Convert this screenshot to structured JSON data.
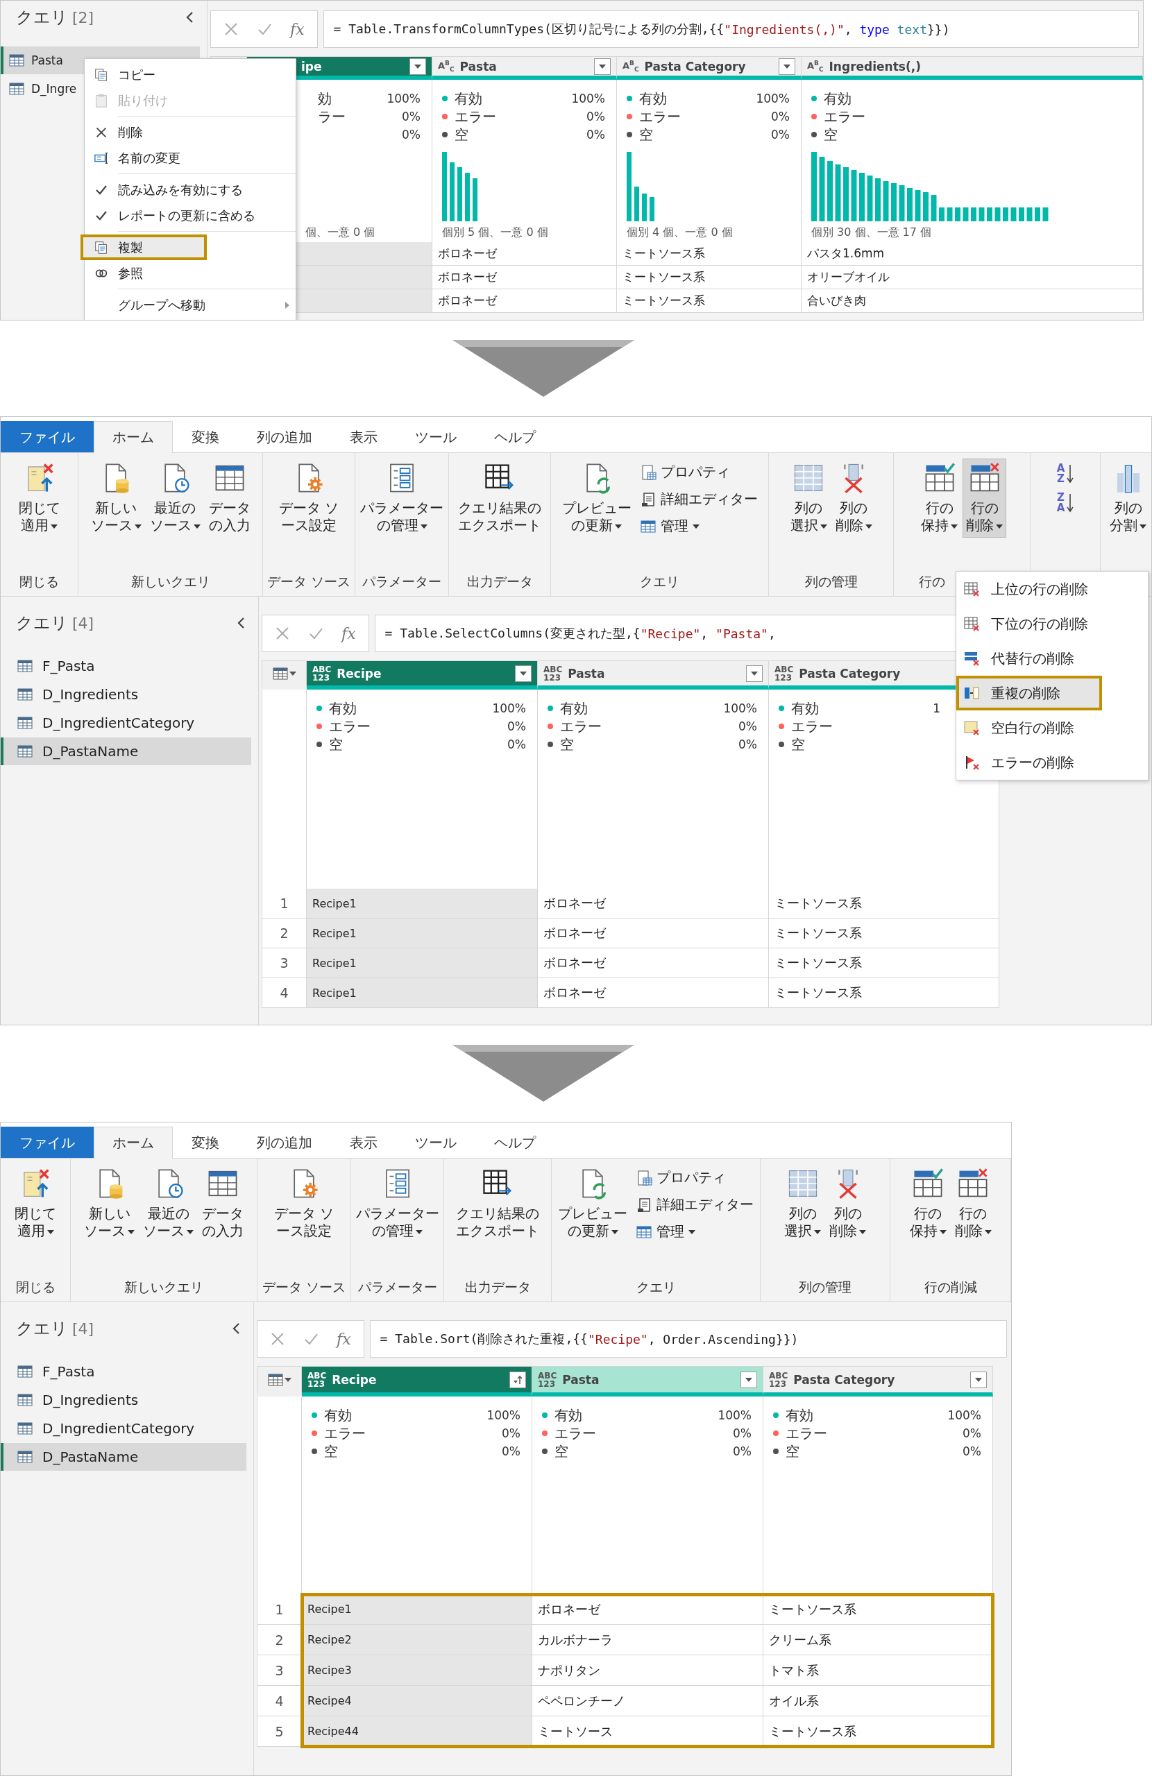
{
  "panels": [
    {
      "sidebar": {
        "title": "クエリ",
        "count": "[2]",
        "items": [
          {
            "label": "Pasta",
            "selected": true
          },
          {
            "label": "D_Ingre",
            "selected": false
          }
        ]
      },
      "formula_bar": {
        "fx": "fx",
        "segments": [
          {
            "kind": "code",
            "text": "= Table.TransformColumnTypes(区切り記号による列の分割,{{"
          },
          {
            "kind": "string",
            "text": "\"Ingredients(,)\""
          },
          {
            "kind": "code",
            "text": ", "
          },
          {
            "kind": "keyword",
            "text": "type"
          },
          {
            "kind": "type",
            "text": " text"
          },
          {
            "kind": "code",
            "text": "}})"
          }
        ]
      },
      "grid": {
        "corner_menu": false,
        "rows_highlighted": false,
        "columns": [
          {
            "name": "ipe",
            "selected": true,
            "highlighted": false,
            "filter_button": true,
            "stats": [
              {
                "label": "効",
                "value": "100%"
              },
              {
                "label": "ラー",
                "value": "0%"
              },
              {
                "value": "0%"
              }
            ],
            "histogram": false,
            "distinct": "個、一意 0 個"
          },
          {
            "type": {
              "kind": "text",
              "letters": [
                "A",
                "B",
                "C"
              ]
            },
            "name": "Pasta",
            "selected": false,
            "highlighted": false,
            "filter_button": true,
            "stats": [
              {
                "label": "有効",
                "value": "100%",
                "color": "#01b8aa"
              },
              {
                "label": "エラー",
                "value": "0%",
                "color": "#fd625e"
              },
              {
                "label": "空",
                "value": "0%",
                "color": "#505050"
              }
            ],
            "histogram": true,
            "distinct": "個別 5 個、一意 0 個"
          },
          {
            "type": {
              "kind": "text",
              "letters": [
                "A",
                "B",
                "C"
              ]
            },
            "name": "Pasta Category",
            "selected": false,
            "highlighted": false,
            "filter_button": true,
            "stats": [
              {
                "label": "有効",
                "value": "100%",
                "color": "#01b8aa"
              },
              {
                "label": "エラー",
                "value": "0%",
                "color": "#fd625e"
              },
              {
                "label": "空",
                "value": "0%",
                "color": "#505050"
              }
            ],
            "histogram": true,
            "distinct": "個別 4 個、一意 0 個"
          },
          {
            "type": {
              "kind": "text",
              "letters": [
                "A",
                "B",
                "C"
              ]
            },
            "name": "Ingredients(,)",
            "selected": false,
            "highlighted": false,
            "filter_button": false,
            "stats": [
              {
                "label": "有効",
                "color": "#01b8aa"
              },
              {
                "label": "エラー",
                "color": "#fd625e"
              },
              {
                "label": "空",
                "color": "#505050"
              }
            ],
            "histogram": true,
            "distinct": "個別 30 個、一意 17 個"
          }
        ],
        "rows": [
          {
            "cells": [
              null,
              "ボロネーゼ",
              "ミートソース系",
              "パスタ1.6mm"
            ]
          },
          {
            "cells": [
              null,
              "ボロネーゼ",
              "ミートソース系",
              "オリーブオイル"
            ]
          },
          {
            "cells": [
              null,
              "ボロネーゼ",
              "ミートソース系",
              "合いびき肉"
            ]
          }
        ]
      },
      "context_menu": {
        "items": [
          {
            "kind": "item",
            "label": "コピー",
            "disabled": false,
            "checked": false,
            "selected": false,
            "submenu": false
          },
          {
            "kind": "item",
            "label": "貼り付け",
            "disabled": true,
            "checked": false,
            "selected": false,
            "submenu": false
          },
          {
            "kind": "separator"
          },
          {
            "kind": "item",
            "label": "削除",
            "disabled": false,
            "checked": false,
            "selected": false,
            "submenu": false
          },
          {
            "kind": "item",
            "label": "名前の変更",
            "disabled": false,
            "checked": false,
            "selected": false,
            "submenu": false
          },
          {
            "kind": "separator"
          },
          {
            "kind": "item",
            "label": "読み込みを有効にする",
            "disabled": false,
            "checked": true,
            "selected": false,
            "submenu": false
          },
          {
            "kind": "item",
            "label": "レポートの更新に含める",
            "disabled": false,
            "checked": true,
            "selected": false,
            "submenu": false
          },
          {
            "kind": "separator"
          },
          {
            "kind": "item",
            "label": "複製",
            "disabled": false,
            "checked": false,
            "selected": true,
            "submenu": false
          },
          {
            "kind": "item",
            "label": "参照",
            "disabled": false,
            "checked": false,
            "selected": false,
            "submenu": false
          },
          {
            "kind": "separator"
          },
          {
            "kind": "item",
            "label": "グループへ移動",
            "disabled": false,
            "checked": false,
            "selected": false,
            "submenu": true
          }
        ]
      }
    },
    {
      "ribbon": {
        "tabs": [
          {
            "kind": "file",
            "label": "ファイル",
            "selected": false
          },
          {
            "kind": "tab",
            "label": "ホーム",
            "selected": true
          },
          {
            "kind": "tab",
            "label": "変換",
            "selected": false
          },
          {
            "kind": "tab",
            "label": "列の追加",
            "selected": false
          },
          {
            "kind": "tab",
            "label": "表示",
            "selected": false
          },
          {
            "kind": "tab",
            "label": "ツール",
            "selected": false
          },
          {
            "kind": "tab",
            "label": "ヘルプ",
            "selected": false
          }
        ],
        "groups": [
          {
            "label": "閉じる",
            "buttons": [
              {
                "kind": "large",
                "lines": [
                  "閉じて",
                  "適用"
                ],
                "dropdown": true,
                "pressed": false
              }
            ]
          },
          {
            "label": "新しいクエリ",
            "buttons": [
              {
                "kind": "large",
                "lines": [
                  "新しい",
                  "ソース"
                ],
                "dropdown": true,
                "pressed": false
              },
              {
                "kind": "large",
                "lines": [
                  "最近の",
                  "ソース"
                ],
                "dropdown": true,
                "pressed": false
              },
              {
                "kind": "large",
                "lines": [
                  "データ",
                  "の入力"
                ],
                "dropdown": false,
                "pressed": false
              }
            ]
          },
          {
            "label": "データ ソース",
            "buttons": [
              {
                "kind": "large",
                "lines": [
                  "データ ソ",
                  "ース設定"
                ],
                "dropdown": false,
                "pressed": false
              }
            ]
          },
          {
            "label": "パラメーター",
            "buttons": [
              {
                "kind": "large",
                "lines": [
                  "パラメーター",
                  "の管理"
                ],
                "dropdown": true,
                "pressed": false
              }
            ]
          },
          {
            "label": "出力データ",
            "buttons": [
              {
                "kind": "large",
                "lines": [
                  "クエリ結果の",
                  "エクスポート"
                ],
                "dropdown": false,
                "pressed": false
              }
            ]
          },
          {
            "label": "クエリ",
            "buttons": [
              {
                "kind": "large",
                "lines": [
                  "プレビュー",
                  "の更新"
                ],
                "dropdown": true,
                "pressed": false
              },
              {
                "kind": "small",
                "label": "プロパティ",
                "dropdown": false,
                "pressed": false
              },
              {
                "kind": "small",
                "label": "詳細エディター",
                "dropdown": false,
                "pressed": false
              },
              {
                "kind": "small",
                "label": "管理",
                "dropdown": true,
                "pressed": false
              }
            ]
          },
          {
            "label": "列の管理",
            "buttons": [
              {
                "kind": "large",
                "lines": [
                  "列の",
                  "選択"
                ],
                "dropdown": true,
                "pressed": false
              },
              {
                "kind": "large",
                "lines": [
                  "列の",
                  "削除"
                ],
                "dropdown": true,
                "pressed": false
              }
            ]
          },
          {
            "label": "行の",
            "buttons": [
              {
                "kind": "large",
                "lines": [
                  "行の",
                  "保持"
                ],
                "dropdown": true,
                "pressed": false
              },
              {
                "kind": "large",
                "lines": [
                  "行の",
                  "削除"
                ],
                "dropdown": true,
                "pressed": true
              }
            ]
          },
          {
            "buttons": [
              {
                "kind": "sort",
                "letters": [
                  "A",
                  "Z"
                ],
                "pressed": false
              },
              {
                "kind": "sort",
                "letters": [
                  "Z",
                  "A"
                ],
                "pressed": false
              }
            ]
          },
          {
            "buttons": [
              {
                "kind": "large",
                "lines": [
                  "列の",
                  "分割"
                ],
                "dropdown": true,
                "pressed": false
              }
            ]
          }
        ]
      },
      "sidebar": {
        "title": "クエリ",
        "count": "[4]",
        "items": [
          {
            "label": "F_Pasta",
            "selected": false
          },
          {
            "label": "D_Ingredients",
            "selected": false
          },
          {
            "label": "D_IngredientCategory",
            "selected": false
          },
          {
            "label": "D_PastaName",
            "selected": true
          }
        ]
      },
      "formula_bar": {
        "fx": "fx",
        "segments": [
          {
            "kind": "code",
            "text": "= Table.SelectColumns(変更された型,{"
          },
          {
            "kind": "string",
            "text": "\"Recipe\""
          },
          {
            "kind": "code",
            "text": ", "
          },
          {
            "kind": "string",
            "text": "\"Pasta\""
          },
          {
            "kind": "code",
            "text": ","
          }
        ]
      },
      "grid": {
        "corner_menu": true,
        "rows_highlighted": false,
        "columns": [
          {
            "type": {
              "kind": "any",
              "letters": [
                "ABC",
                "123"
              ]
            },
            "name": "Recipe",
            "selected": true,
            "highlighted": false,
            "filter_button": true,
            "stats": [
              {
                "label": "有効",
                "value": "100%",
                "color": "#01b8aa"
              },
              {
                "label": "エラー",
                "value": "0%",
                "color": "#fd625e"
              },
              {
                "label": "空",
                "value": "0%",
                "color": "#505050"
              }
            ]
          },
          {
            "type": {
              "kind": "any",
              "letters": [
                "ABC",
                "123"
              ]
            },
            "name": "Pasta",
            "selected": false,
            "highlighted": false,
            "filter_button": true,
            "stats": [
              {
                "label": "有効",
                "value": "100%",
                "color": "#01b8aa"
              },
              {
                "label": "エラー",
                "value": "0%",
                "color": "#fd625e"
              },
              {
                "label": "空",
                "value": "0%",
                "color": "#505050"
              }
            ]
          },
          {
            "type": {
              "kind": "any",
              "letters": [
                "ABC",
                "123"
              ]
            },
            "name": "Pasta Category",
            "selected": false,
            "highlighted": false,
            "stats": [
              {
                "label": "有効",
                "value": "1",
                "color": "#01b8aa"
              },
              {
                "label": "エラー",
                "color": "#fd625e"
              },
              {
                "label": "空",
                "color": "#505050"
              }
            ]
          }
        ],
        "rows": [
          {
            "number": "1",
            "cells": [
              "Recipe1",
              "ボロネーゼ",
              "ミートソース系"
            ]
          },
          {
            "number": "2",
            "cells": [
              "Recipe1",
              "ボロネーゼ",
              "ミートソース系"
            ]
          },
          {
            "number": "3",
            "cells": [
              "Recipe1",
              "ボロネーゼ",
              "ミートソース系"
            ]
          },
          {
            "number": "4",
            "cells": [
              "Recipe1",
              "ボロネーゼ",
              "ミートソース系"
            ]
          }
        ]
      },
      "dropdown_menu": {
        "items": [
          {
            "label": "上位の行の削除",
            "selected": false
          },
          {
            "label": "下位の行の削除",
            "selected": false
          },
          {
            "label": "代替行の削除",
            "selected": false
          },
          {
            "label": "重複の削除",
            "selected": true
          },
          {
            "label": "空白行の削除",
            "selected": false
          },
          {
            "label": "エラーの削除",
            "selected": false
          }
        ]
      }
    },
    {
      "ribbon": {
        "tabs": [
          {
            "kind": "file",
            "label": "ファイル",
            "selected": false
          },
          {
            "kind": "tab",
            "label": "ホーム",
            "selected": true
          },
          {
            "kind": "tab",
            "label": "変換",
            "selected": false
          },
          {
            "kind": "tab",
            "label": "列の追加",
            "selected": false
          },
          {
            "kind": "tab",
            "label": "表示",
            "selected": false
          },
          {
            "kind": "tab",
            "label": "ツール",
            "selected": false
          },
          {
            "kind": "tab",
            "label": "ヘルプ",
            "selected": false
          }
        ],
        "groups": [
          {
            "label": "閉じる",
            "buttons": [
              {
                "kind": "large",
                "lines": [
                  "閉じて",
                  "適用"
                ],
                "dropdown": true,
                "pressed": false
              }
            ]
          },
          {
            "label": "新しいクエリ",
            "buttons": [
              {
                "kind": "large",
                "lines": [
                  "新しい",
                  "ソース"
                ],
                "dropdown": true,
                "pressed": false
              },
              {
                "kind": "large",
                "lines": [
                  "最近の",
                  "ソース"
                ],
                "dropdown": true,
                "pressed": false
              },
              {
                "kind": "large",
                "lines": [
                  "データ",
                  "の入力"
                ],
                "dropdown": false,
                "pressed": false
              }
            ]
          },
          {
            "label": "データ ソース",
            "buttons": [
              {
                "kind": "large",
                "lines": [
                  "データ ソ",
                  "ース設定"
                ],
                "dropdown": false,
                "pressed": false
              }
            ]
          },
          {
            "label": "パラメーター",
            "buttons": [
              {
                "kind": "large",
                "lines": [
                  "パラメーター",
                  "の管理"
                ],
                "dropdown": true,
                "pressed": false
              }
            ]
          },
          {
            "label": "出力データ",
            "buttons": [
              {
                "kind": "large",
                "lines": [
                  "クエリ結果の",
                  "エクスポート"
                ],
                "dropdown": false,
                "pressed": false
              }
            ]
          },
          {
            "label": "クエリ",
            "buttons": [
              {
                "kind": "large",
                "lines": [
                  "プレビュー",
                  "の更新"
                ],
                "dropdown": true,
                "pressed": false
              },
              {
                "kind": "small",
                "label": "プロパティ",
                "dropdown": false,
                "pressed": false
              },
              {
                "kind": "small",
                "label": "詳細エディター",
                "dropdown": false,
                "pressed": false
              },
              {
                "kind": "small",
                "label": "管理",
                "dropdown": true,
                "pressed": false
              }
            ]
          },
          {
            "label": "列の管理",
            "buttons": [
              {
                "kind": "large",
                "lines": [
                  "列の",
                  "選択"
                ],
                "dropdown": true,
                "pressed": false
              },
              {
                "kind": "large",
                "lines": [
                  "列の",
                  "削除"
                ],
                "dropdown": true,
                "pressed": false
              }
            ]
          },
          {
            "label": "行の削減",
            "buttons": [
              {
                "kind": "large",
                "lines": [
                  "行の",
                  "保持"
                ],
                "dropdown": true,
                "pressed": false
              },
              {
                "kind": "large",
                "lines": [
                  "行の",
                  "削除"
                ],
                "dropdown": true,
                "pressed": false
              }
            ]
          }
        ]
      },
      "sidebar": {
        "title": "クエリ",
        "count": "[4]",
        "items": [
          {
            "label": "F_Pasta",
            "selected": false
          },
          {
            "label": "D_Ingredients",
            "selected": false
          },
          {
            "label": "D_IngredientCategory",
            "selected": false
          },
          {
            "label": "D_PastaName",
            "selected": true
          }
        ]
      },
      "formula_bar": {
        "fx": "fx",
        "segments": [
          {
            "kind": "code",
            "text": "= Table.Sort(削除された重複,{{"
          },
          {
            "kind": "string",
            "text": "\"Recipe\""
          },
          {
            "kind": "code",
            "text": ", Order.Ascending}})"
          }
        ]
      },
      "grid": {
        "corner_menu": true,
        "rows_highlighted": true,
        "columns": [
          {
            "type": {
              "kind": "any",
              "letters": [
                "ABC",
                "123"
              ]
            },
            "name": "Recipe",
            "selected": true,
            "highlighted": false,
            "filter_button": false,
            "sort_button": true,
            "stats": [
              {
                "label": "有効",
                "value": "100%",
                "color": "#01b8aa"
              },
              {
                "label": "エラー",
                "value": "0%",
                "color": "#fd625e"
              },
              {
                "label": "空",
                "value": "0%",
                "color": "#505050"
              }
            ]
          },
          {
            "type": {
              "kind": "any",
              "letters": [
                "ABC",
                "123"
              ]
            },
            "name": "Pasta",
            "selected": false,
            "highlighted": true,
            "filter_button": true,
            "sort_button": false,
            "stats": [
              {
                "label": "有効",
                "value": "100%",
                "color": "#01b8aa"
              },
              {
                "label": "エラー",
                "value": "0%",
                "color": "#fd625e"
              },
              {
                "label": "空",
                "value": "0%",
                "color": "#505050"
              }
            ]
          },
          {
            "type": {
              "kind": "any",
              "letters": [
                "ABC",
                "123"
              ]
            },
            "name": "Pasta Category",
            "selected": false,
            "highlighted": false,
            "filter_button": true,
            "sort_button": false,
            "stats": [
              {
                "label": "有効",
                "value": "100%",
                "color": "#01b8aa"
              },
              {
                "label": "エラー",
                "value": "0%",
                "color": "#fd625e"
              },
              {
                "label": "空",
                "value": "0%",
                "color": "#505050"
              }
            ]
          }
        ],
        "rows": [
          {
            "number": "1",
            "cells": [
              "Recipe1",
              "ボロネーゼ",
              "ミートソース系"
            ]
          },
          {
            "number": "2",
            "cells": [
              "Recipe2",
              "カルボナーラ",
              "クリーム系"
            ]
          },
          {
            "number": "3",
            "cells": [
              "Recipe3",
              "ナポリタン",
              "トマト系"
            ]
          },
          {
            "number": "4",
            "cells": [
              "Recipe4",
              "ペペロンチーノ",
              "オイル系"
            ]
          },
          {
            "number": "5",
            "cells": [
              "Recipe44",
              "ミートソース",
              "ミートソース系"
            ]
          }
        ]
      }
    }
  ]
}
